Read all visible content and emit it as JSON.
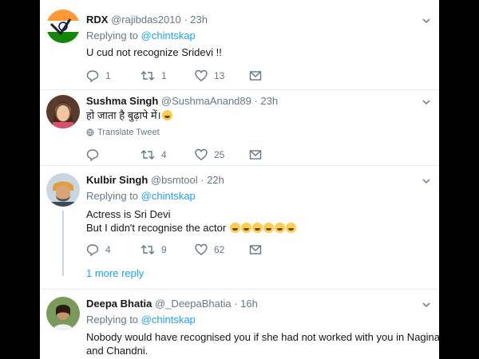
{
  "tweets": [
    {
      "name": "RDX",
      "handle": "@rajibdas2010",
      "time": "· 23h",
      "replying_label": "Replying to",
      "mention": "@chintskap",
      "text": "U cud not recognize Sridevi !!",
      "replies": "1",
      "retweets": "1",
      "likes": "13"
    },
    {
      "name": "Sushma Singh",
      "handle": "@SushmaAnand89",
      "time": "· 23h",
      "text": "हो जाता है बुढ़ापे में।",
      "translate": "Translate Tweet",
      "replies": "",
      "retweets": "4",
      "likes": "25"
    },
    {
      "name": "Kulbir Singh",
      "handle": "@bsmtool",
      "time": "· 22h",
      "replying_label": "Replying to",
      "mention": "@chintskap",
      "text_line1": "Actress is Sri Devi",
      "text_line2": "But I didn't recognise the actor",
      "replies": "4",
      "retweets": "9",
      "likes": "62",
      "more_replies": "1 more reply"
    },
    {
      "name": "Deepa Bhatia",
      "handle": "@_DeepaBhatia",
      "time": "· 16h",
      "replying_label": "Replying to",
      "mention": "@chintskap",
      "text_line1": "Nobody would have recognised you if she had not worked with you in Nagina",
      "text_line2": "and Chandni."
    }
  ],
  "icons": {
    "reply": "reply-icon",
    "retweet": "retweet-icon",
    "like": "heart-icon",
    "dm": "envelope-icon",
    "caret": "chevron-down-icon",
    "globe": "globe-icon"
  },
  "colors": {
    "link": "#1da1f2",
    "muted": "#657786",
    "text": "#14171a",
    "background_outer": "#000000",
    "background_panel": "#ffffff"
  }
}
